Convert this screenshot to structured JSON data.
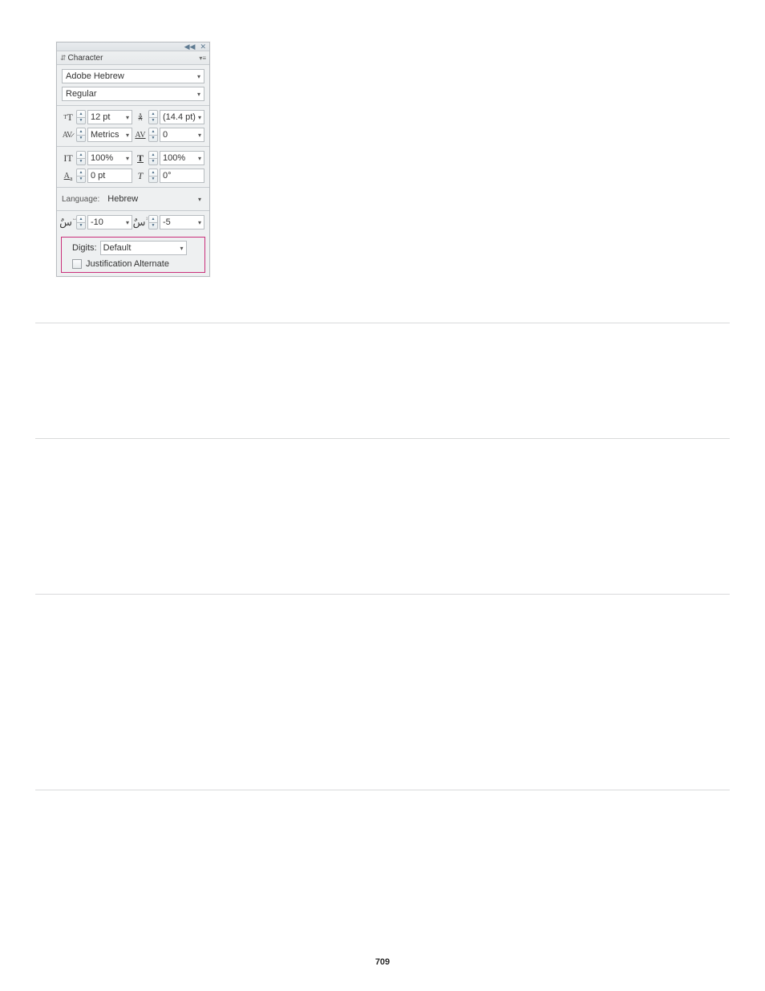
{
  "panel": {
    "title": "Character",
    "font_family": "Adobe Hebrew",
    "font_style": "Regular"
  },
  "size": {
    "value": "12 pt"
  },
  "leading": {
    "value": "(14.4 pt)"
  },
  "kerning": {
    "value": "Metrics"
  },
  "tracking": {
    "value": "0"
  },
  "vscale": {
    "value": "100%"
  },
  "hscale": {
    "value": "100%"
  },
  "baseline": {
    "value": "0 pt"
  },
  "skew": {
    "value": "0°"
  },
  "language": {
    "label": "Language:",
    "value": "Hebrew"
  },
  "diacritic_h": {
    "value": "-10"
  },
  "diacritic_v": {
    "value": "-5"
  },
  "digits": {
    "label": "Digits:",
    "value": "Default"
  },
  "justification": {
    "label": "Justification Alternate"
  },
  "page_number": "709"
}
